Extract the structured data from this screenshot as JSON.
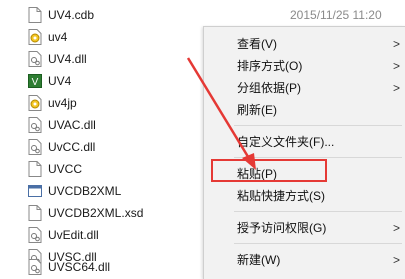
{
  "files": [
    {
      "name": "UV4.cdb",
      "icon": "file-icon",
      "date": "2015/11/25 11:20"
    },
    {
      "name": "uv4",
      "icon": "settings-file-icon",
      "date": ""
    },
    {
      "name": "UV4.dll",
      "icon": "dll-icon",
      "date": ""
    },
    {
      "name": "UV4",
      "icon": "uvision-app-icon",
      "date": ""
    },
    {
      "name": "uv4jp",
      "icon": "settings-file-icon",
      "date": ""
    },
    {
      "name": "UVAC.dll",
      "icon": "dll-icon",
      "date": ""
    },
    {
      "name": "UvCC.dll",
      "icon": "dll-icon",
      "date": ""
    },
    {
      "name": "UVCC",
      "icon": "file-icon",
      "date": ""
    },
    {
      "name": "UVCDB2XML",
      "icon": "app-window-icon",
      "date": ""
    },
    {
      "name": "UVCDB2XML.xsd",
      "icon": "file-icon",
      "date": ""
    },
    {
      "name": "UvEdit.dll",
      "icon": "dll-icon",
      "date": ""
    },
    {
      "name": "UVSC.dll",
      "icon": "dll-icon",
      "date": ""
    },
    {
      "name": "UVSC64.dll",
      "icon": "dll-icon",
      "date": ""
    }
  ],
  "menu": {
    "view": "查看(V)",
    "sort_by": "排序方式(O)",
    "group_by": "分组依据(P)",
    "refresh": "刷新(E)",
    "customize_folder": "自定义文件夹(F)...",
    "paste": "粘贴(P)",
    "paste_shortcut": "粘贴快捷方式(S)",
    "give_access": "授予访问权限(G)",
    "new": "新建(W)",
    "submenu_arrow": ">"
  },
  "colors": {
    "highlight": "#e53935",
    "arrow": "#e53935"
  }
}
